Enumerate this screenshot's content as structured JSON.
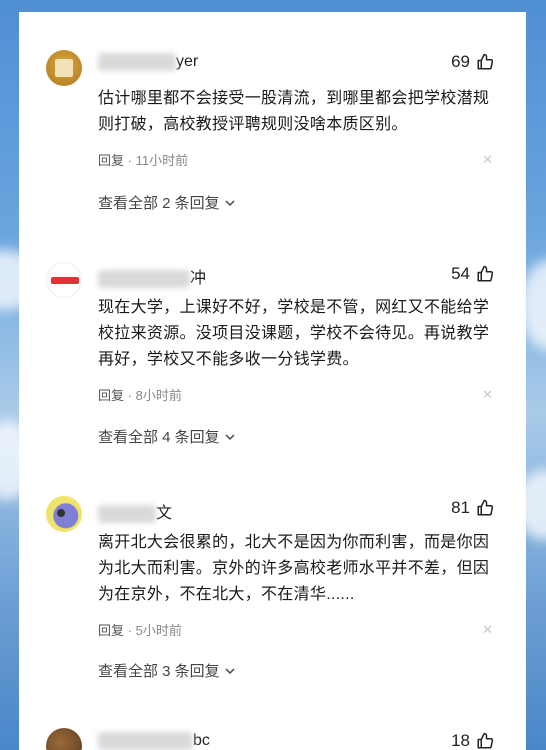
{
  "comments": [
    {
      "name_suffix": "yer",
      "likes": "69",
      "text": "估计哪里都不会接受一股清流，到哪里都会把学校潜规则打破，高校教授评聘规则没啥本质区别。",
      "reply_label": "回复",
      "time": "11小时前",
      "view_all": "查看全部 2 条回复"
    },
    {
      "name_suffix": "冲",
      "likes": "54",
      "text": "现在大学，上课好不好，学校是不管，网红又不能给学校拉来资源。没项目没课题，学校不会待见。再说教学再好，学校又不能多收一分钱学费。",
      "reply_label": "回复",
      "time": "8小时前",
      "view_all": "查看全部 4 条回复"
    },
    {
      "name_suffix": "文",
      "likes": "81",
      "text": "离开北大会很累的，北大不是因为你而利害，而是你因为北大而利害。京外的许多高校老师水平并不差，但因为在京外，不在北大，不在清华......",
      "reply_label": "回复",
      "time": "5小时前",
      "view_all": "查看全部 3 条回复"
    },
    {
      "name_suffix": "bc",
      "likes": "18"
    }
  ],
  "colors": {
    "background_sky": "#6aa4de",
    "panel": "#ffffff",
    "meta_text": "#888888"
  }
}
